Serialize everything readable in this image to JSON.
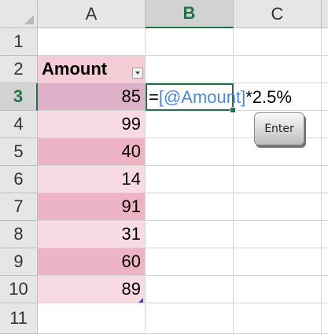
{
  "columns": [
    "A",
    "B",
    "C"
  ],
  "rows": [
    "1",
    "2",
    "3",
    "4",
    "5",
    "6",
    "7",
    "8",
    "9",
    "10",
    "11"
  ],
  "table": {
    "header": "Amount",
    "values": [
      "85",
      "99",
      "40",
      "14",
      "91",
      "31",
      "60",
      "89"
    ]
  },
  "formula": {
    "equals": "=",
    "reference": "[@Amount]",
    "rest": "*2.5%"
  },
  "key": {
    "label": "Enter"
  },
  "colors": {
    "accent": "#217346",
    "table_header": "#f4ccd6",
    "band_dark": "#ecb4c4",
    "band_light": "#f8dbe2",
    "reference": "#4a86e8"
  }
}
